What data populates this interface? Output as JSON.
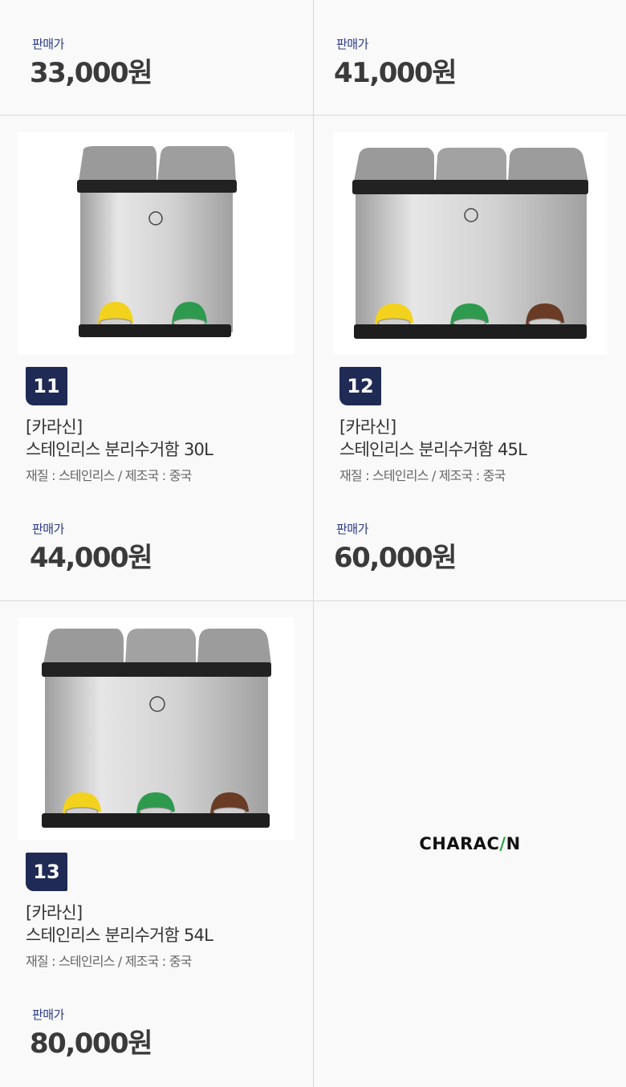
{
  "price_label": "판매가",
  "top_row": [
    {
      "price": "33,000원"
    },
    {
      "price": "41,000원"
    }
  ],
  "products": [
    {
      "number": "11",
      "brand": "[카라신]",
      "name": "스테인리스 분리수거함 30L",
      "spec": "재질 : 스테인리스 / 제조국 : 중국",
      "price": "44,000원",
      "bins": 2
    },
    {
      "number": "12",
      "brand": "[카라신]",
      "name": "스테인리스 분리수거함 45L",
      "spec": "재질 : 스테인리스 / 제조국 : 중국",
      "price": "60,000원",
      "bins": 3
    },
    {
      "number": "13",
      "brand": "[카라신]",
      "name": "스테인리스 분리수거함 54L",
      "spec": "재질 : 스테인리스 / 제조국 : 중국",
      "price": "80,000원",
      "bins": 3
    }
  ],
  "logo": {
    "before": "CHARAC",
    "slash": "/",
    "after": "N"
  },
  "colors": {
    "badge": "#1f2a55",
    "price_label": "#2a3a8c",
    "pedal_yellow": "#f2d21c",
    "pedal_green": "#2e9a4e",
    "pedal_brown": "#6a3b25"
  }
}
